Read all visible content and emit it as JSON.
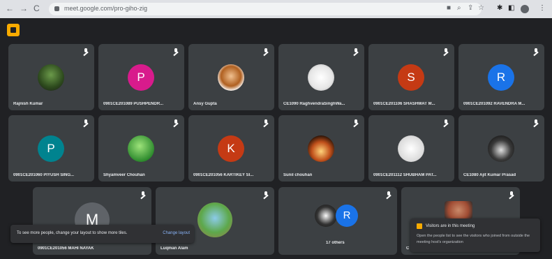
{
  "browser": {
    "back": "←",
    "forward": "→",
    "reload": "C",
    "url": "meet.google.com/pro-giho-zig",
    "toolbar_icons": [
      "cast-icon",
      "zoom-icon",
      "share-icon",
      "star-icon",
      "extensions-icon",
      "sidepanel-icon",
      "profile-icon",
      "menu-icon"
    ]
  },
  "tiles": [
    {
      "name": "Rajnish Kumar"
    },
    {
      "name": "0901CE201089 PUSHPENDR...",
      "initial": "P"
    },
    {
      "name": "Ansy Gupta"
    },
    {
      "name": "CE1090 RaghvendraSinghWa..."
    },
    {
      "name": "0901CE201106 SHASHWAT M...",
      "initial": "S"
    },
    {
      "name": "0901CE201092 RAVENDRA M...",
      "initial": "R"
    },
    {
      "name": "0901CE201060 PIYUSH SING...",
      "initial": "P"
    },
    {
      "name": "Shyamveer Chouhan"
    },
    {
      "name": "0901CE201056 KARTIKEY SI...",
      "initial": "K"
    },
    {
      "name": "Sunil chouhan"
    },
    {
      "name": "0901CE201112 SHUBHAM PAT...",
      "initial": ""
    },
    {
      "name": "CE1080 Ajit Kumar Prasad"
    },
    {
      "name": "0901CE201056 MAHI NAYAK",
      "initial": "M"
    },
    {
      "name": "Luqman Alam"
    },
    {
      "name": "17 others",
      "initial": "R"
    },
    {
      "name": "C"
    }
  ],
  "toast": {
    "text": "To see more people, change your layout to show more tiles.",
    "link": "Change layout"
  },
  "visitors": {
    "title": "Visitors are in this meeting",
    "body": "Open the people list to see the visitors who joined from outside the meeting host's organization"
  },
  "colors": {
    "tile_bg": "#3c4043",
    "page_bg": "#202124",
    "pink": "#d81b8c",
    "teal": "#00838f",
    "orange": "#c53a14",
    "blue": "#1a73e8",
    "gray": "#5f6368"
  }
}
